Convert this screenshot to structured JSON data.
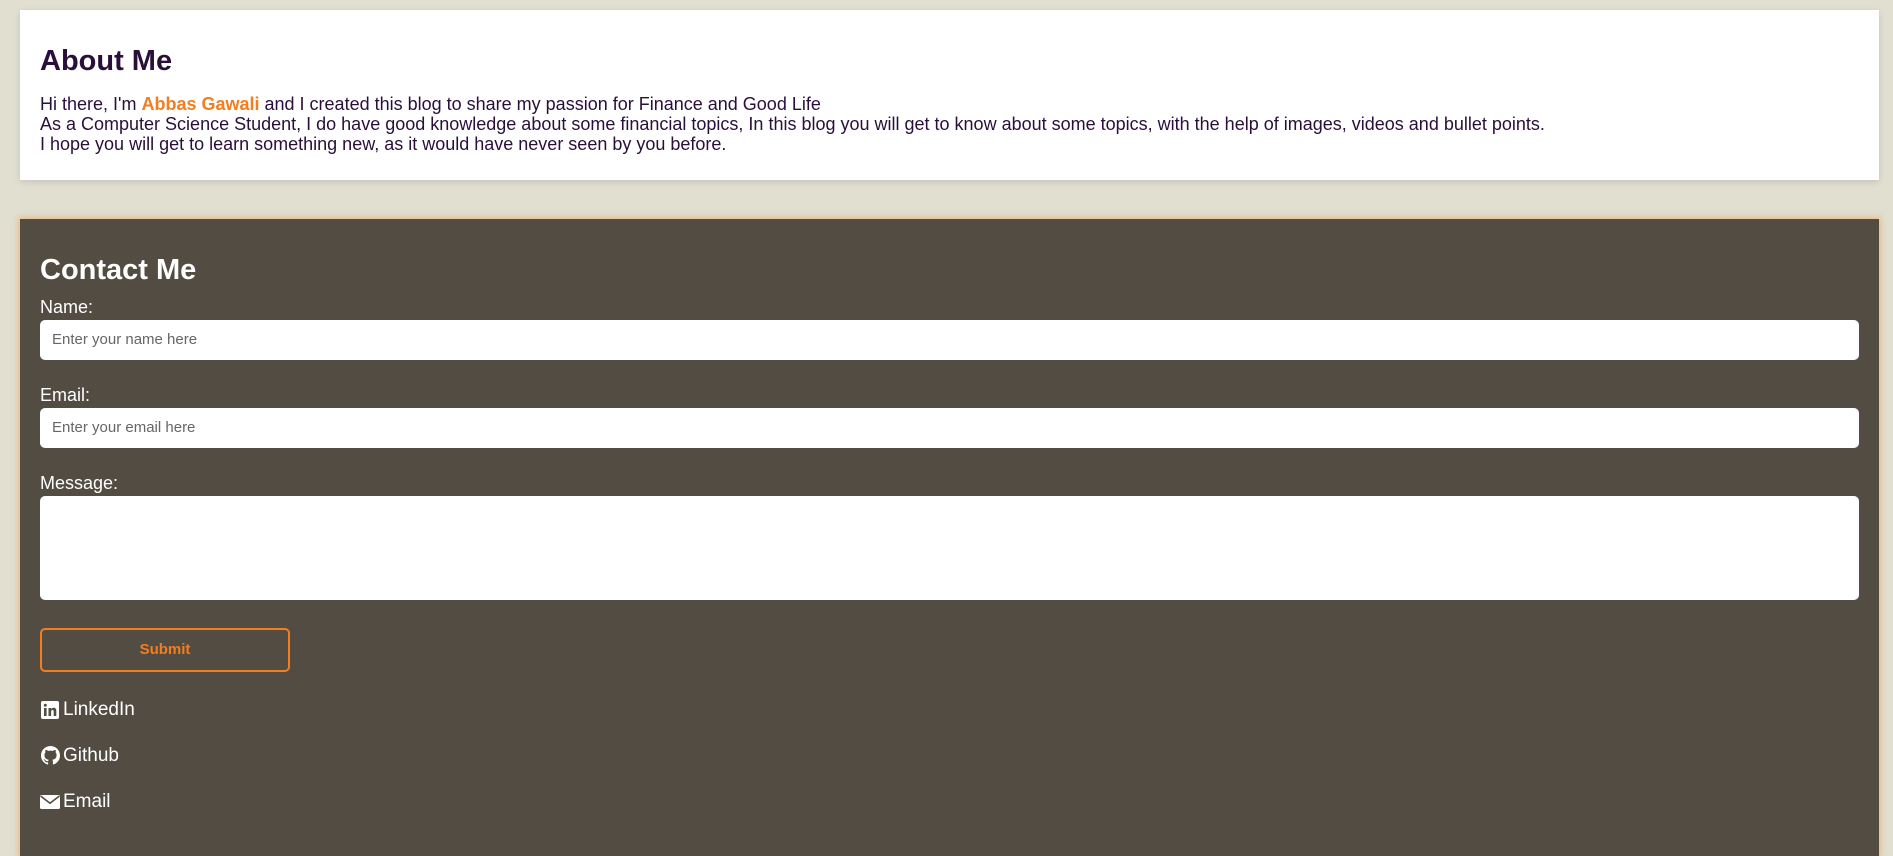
{
  "about": {
    "title": "About Me",
    "line1_prefix": "Hi there, I'm ",
    "line1_name": "Abbas Gawali",
    "line1_suffix": " and I created this blog to share my passion for Finance and Good Life",
    "line2": "As a Computer Science Student, I do have good knowledge about some financial topics, In this blog you will get to know about some topics, with the help of images, videos and bullet points.",
    "line3": "I hope you will get to learn something new, as it would have never seen by you before."
  },
  "contact": {
    "title": "Contact Me",
    "name_label": "Name:",
    "name_placeholder": "Enter your name here",
    "email_label": "Email:",
    "email_placeholder": "Enter your email here",
    "message_label": "Message:",
    "submit_label": "Submit",
    "links": [
      {
        "label": "LinkedIn",
        "icon": "linkedin-icon"
      },
      {
        "label": "Github",
        "icon": "github-icon"
      },
      {
        "label": "Email",
        "icon": "envelope-icon"
      }
    ]
  },
  "colors": {
    "page_background": "#e0dfd0",
    "contact_background": "#524c42",
    "accent": "#f37d1f",
    "heading_text": "#2a0f3a"
  }
}
